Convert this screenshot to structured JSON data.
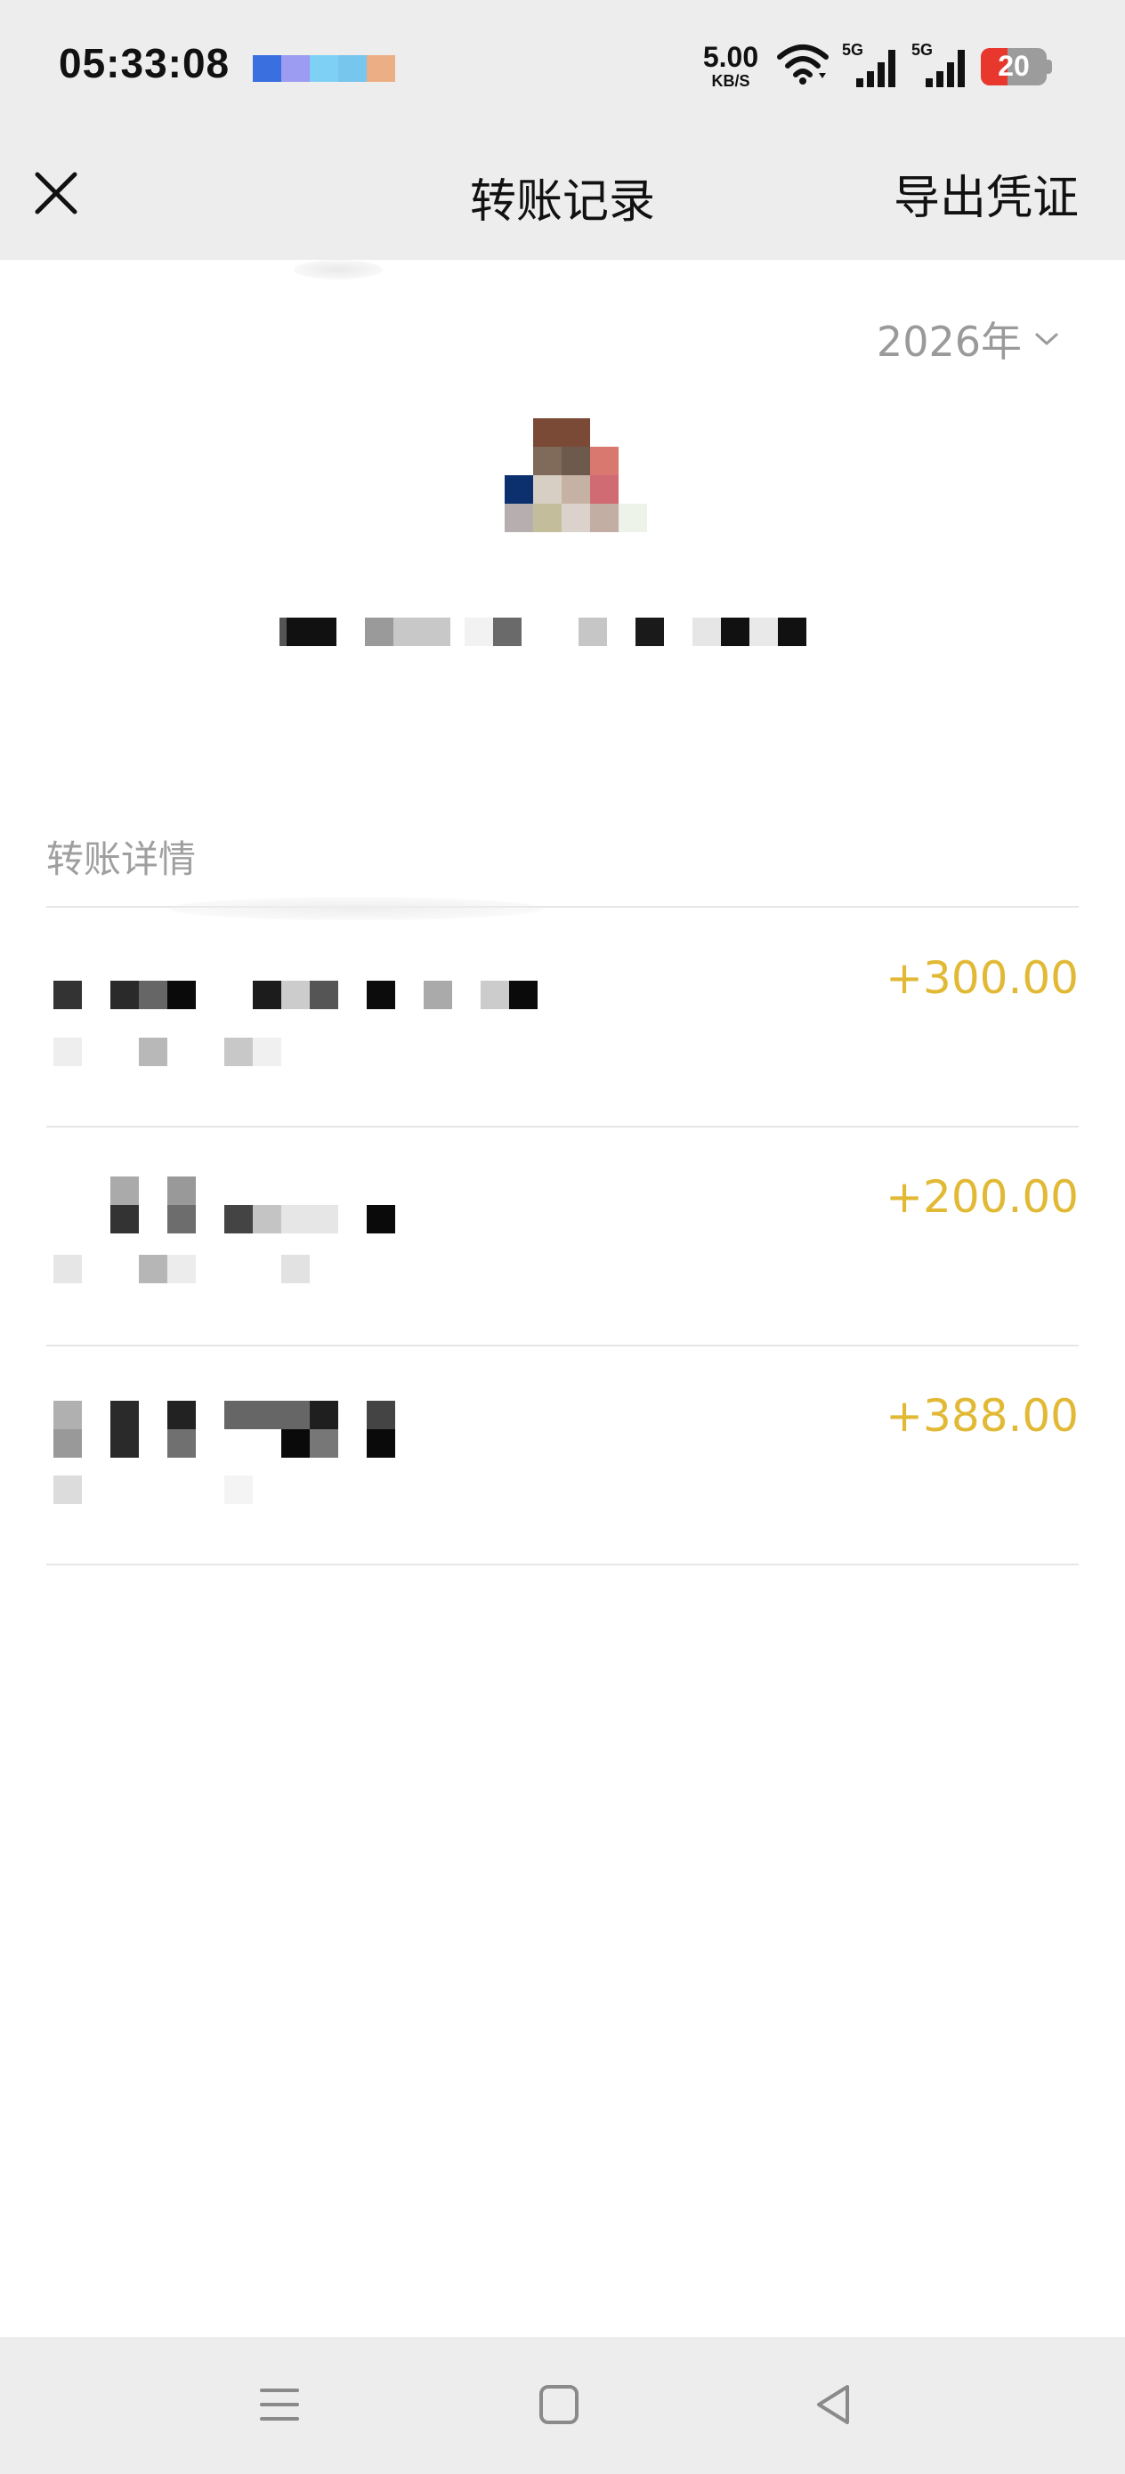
{
  "status_bar": {
    "time": "05:33:08",
    "net_speed": "5.00",
    "net_speed_unit": "KB/S",
    "signal_1_label": "5G",
    "signal_2_label": "5G",
    "battery": "20",
    "notif_colors": [
      "#3a6fe0",
      "#9b9cf2",
      "#7fd0f5",
      "#76c6ee",
      "#ecae84"
    ]
  },
  "navbar": {
    "title": "转账记录",
    "export_label": "导出凭证",
    "close_icon": "close-icon"
  },
  "filter": {
    "year": "2026年",
    "dropdown_icon": "chevron-down-icon"
  },
  "section": {
    "label": "转账详情"
  },
  "transactions": [
    {
      "amount": "+300.00"
    },
    {
      "amount": "+200.00"
    },
    {
      "amount": "+388.00"
    }
  ],
  "colors": {
    "amount": "#e1b935",
    "bar_bg": "#ededed",
    "muted_text": "#9f9f9f"
  },
  "bottom_nav": {
    "menu_icon": "menu-icon",
    "home_icon": "home-icon",
    "back_icon": "back-icon"
  }
}
